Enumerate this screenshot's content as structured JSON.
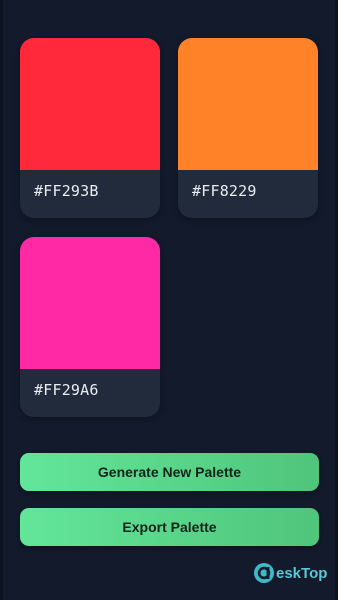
{
  "palette": {
    "colors": [
      {
        "hex": "#FF293B",
        "label": "#FF293B"
      },
      {
        "hex": "#FF8229",
        "label": "#FF8229"
      },
      {
        "hex": "#FF29A6",
        "label": "#FF29A6"
      }
    ]
  },
  "actions": {
    "generate_label": "Generate New Palette",
    "export_label": "Export Palette"
  },
  "watermark": {
    "text": "eskTop"
  }
}
